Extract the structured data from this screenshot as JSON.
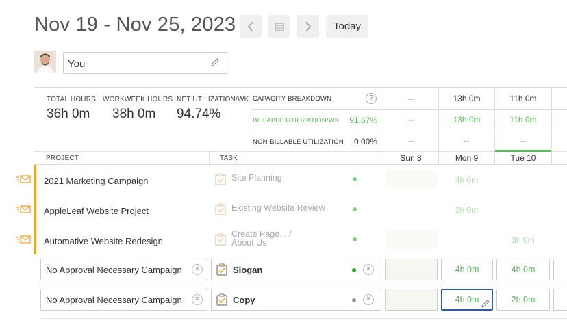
{
  "header": {
    "date_range": "Nov 19 - Nov 25, 2023",
    "today_label": "Today"
  },
  "user": {
    "name": "You"
  },
  "summary": {
    "total_hours_label": "TOTAL HOURS",
    "total_hours": "36h 0m",
    "workweek_hours_label": "WORKWEEK HOURS",
    "workweek_hours": "38h 0m",
    "net_util_label": "NET UTILIZATION/WK",
    "net_util": "94.74%"
  },
  "capacity": {
    "title": "CAPACITY BREAKDOWN",
    "help": "?",
    "billable_label": "BILLABLE UTILIZATION/WK",
    "billable_value": "91.67%",
    "nonbillable_label": "NON-BILLABLE UTILIZATION",
    "nonbillable_value": "0.00%"
  },
  "days": [
    {
      "name": "Sun 8",
      "capacity": "--",
      "billable": "--",
      "nonbillable": "--"
    },
    {
      "name": "Mon 9",
      "capacity": "13h 0m",
      "billable": "13h 0m",
      "nonbillable": "--"
    },
    {
      "name": "Tue 10",
      "capacity": "11h 0m",
      "billable": "11h 0m",
      "nonbillable": "--"
    }
  ],
  "columns": {
    "project": "PROJECT",
    "task": "TASK"
  },
  "rows": [
    {
      "project": "2021 Marketing Campaign",
      "task": "Site Planning",
      "mon": "4h 0m",
      "tue": ""
    },
    {
      "project": "AppleLeaf Website Project",
      "task": "Existing Website Review",
      "mon": "2h 0m",
      "tue": ""
    },
    {
      "project": "Automative Website Redesign",
      "task_line1": "Create Page... /",
      "task_line2": "About Us",
      "mon": "",
      "tue": "3h 0m"
    }
  ],
  "edit_rows": [
    {
      "project": "No Approval Necessary Campaign",
      "task": "Slogan",
      "mon": "4h 0m",
      "tue": "4h 0m"
    },
    {
      "project": "No Approval Necessary Campaign",
      "task": "Copy",
      "mon": "4h 0m",
      "tue": "2h 0m"
    }
  ],
  "colors": {
    "accent_green": "#5cb85c",
    "project_bar": "#f0a020",
    "active_border": "#2e5aa8"
  }
}
